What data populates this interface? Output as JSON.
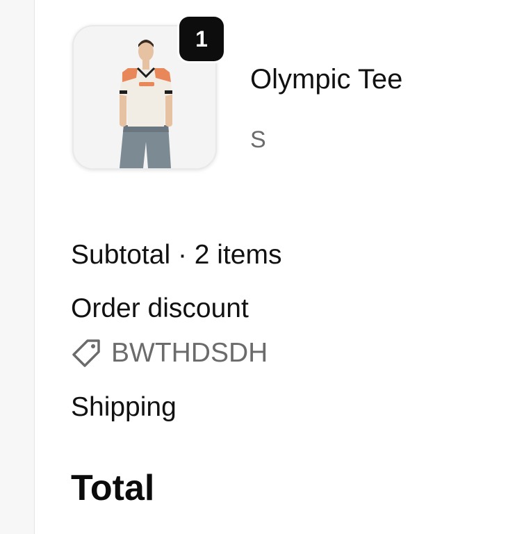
{
  "line_item": {
    "quantity": "1",
    "name": "Olympic Tee",
    "variant": "S",
    "image_icon": "product-photo-man-in-tee"
  },
  "summary": {
    "subtotal_label": "Subtotal · 2 items",
    "discount_label": "Order discount",
    "discount_code": "BWTHDSDH",
    "discount_icon": "tag-icon",
    "shipping_label": "Shipping",
    "total_label": "Total"
  },
  "colors": {
    "text": "#111111",
    "muted": "#6b6b6b",
    "badge": "#0d0d0d",
    "accent_orange": "#e8875a"
  }
}
